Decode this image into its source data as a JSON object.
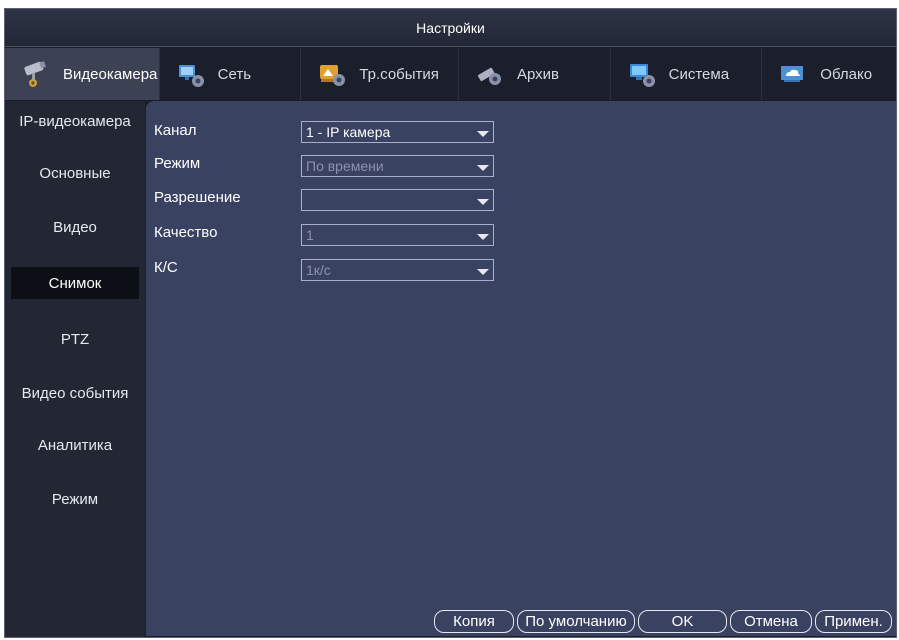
{
  "window": {
    "title": "Настройки"
  },
  "tabs": [
    {
      "label": "Видеокамера",
      "icon": "camera-icon"
    },
    {
      "label": "Сеть",
      "icon": "network-icon"
    },
    {
      "label": "Тр.события",
      "icon": "alarm-events-icon"
    },
    {
      "label": "Архив",
      "icon": "storage-icon"
    },
    {
      "label": "Система",
      "icon": "system-icon"
    },
    {
      "label": "Облако",
      "icon": "cloud-icon"
    }
  ],
  "sidebar": {
    "items": [
      {
        "label": "IP-видеокамера"
      },
      {
        "label": "Основные"
      },
      {
        "label": "Видео"
      },
      {
        "label": "Снимок",
        "active": true
      },
      {
        "label": "PTZ"
      },
      {
        "label": "Видео события"
      },
      {
        "label": "Аналитика"
      },
      {
        "label": "Режим"
      }
    ]
  },
  "form": {
    "channel": {
      "label": "Канал",
      "value": "1 - IP камера"
    },
    "mode": {
      "label": "Режим",
      "value": "По времени"
    },
    "resolution": {
      "label": "Разрешение",
      "value": ""
    },
    "quality": {
      "label": "Качество",
      "value": "1"
    },
    "fps": {
      "label": "К/С",
      "value": "1к/с"
    }
  },
  "buttons": {
    "copy": "Копия",
    "default": "По умолчанию",
    "ok": "OK",
    "cancel": "Отмена",
    "apply": "Примен."
  }
}
